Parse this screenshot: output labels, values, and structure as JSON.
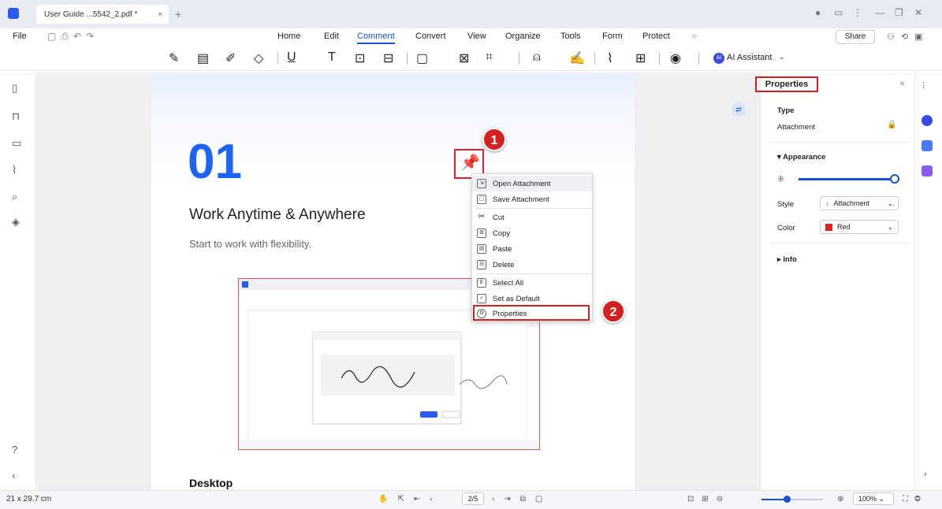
{
  "titlebar": {
    "tab_title": "User Guide ...5542_2.pdf *",
    "tab_close": "×",
    "new_tab": "+"
  },
  "menu": {
    "file": "File",
    "items": [
      "Home",
      "Edit",
      "Comment",
      "Convert",
      "View",
      "Organize",
      "Tools",
      "Form",
      "Protect"
    ],
    "active": "Comment",
    "share": "Share"
  },
  "toolbar": {
    "ai_label": "AI Assistant",
    "ai_badge": "AI"
  },
  "document": {
    "number": "01",
    "heading": "Work Anytime & Anywhere",
    "subheading": "Start to work with flexibility.",
    "section": "Desktop"
  },
  "callouts": {
    "step1": "1",
    "step2": "2"
  },
  "context_menu": {
    "items": [
      "Open Attachment",
      "Save Attachment",
      "Cut",
      "Copy",
      "Paste",
      "Delete",
      "Select All",
      "Set as Default",
      "Properties"
    ],
    "highlighted": "Properties"
  },
  "properties_panel": {
    "title": "Properties",
    "type_label": "Type",
    "type_value": "Attachment",
    "appearance_label": "Appearance",
    "opacity_level": 1.0,
    "style_label": "Style",
    "style_value": "Attachment",
    "color_label": "Color",
    "color_value": "Red",
    "color_swatch": "#e02020",
    "info_label": "Info"
  },
  "statusbar": {
    "page_size": "21 x 29.7 cm",
    "page_indicator": "2/5",
    "zoom": "100%"
  },
  "colors": {
    "accent": "#1a4fd6",
    "highlight": "#d32020",
    "number": "#1d63f5"
  }
}
